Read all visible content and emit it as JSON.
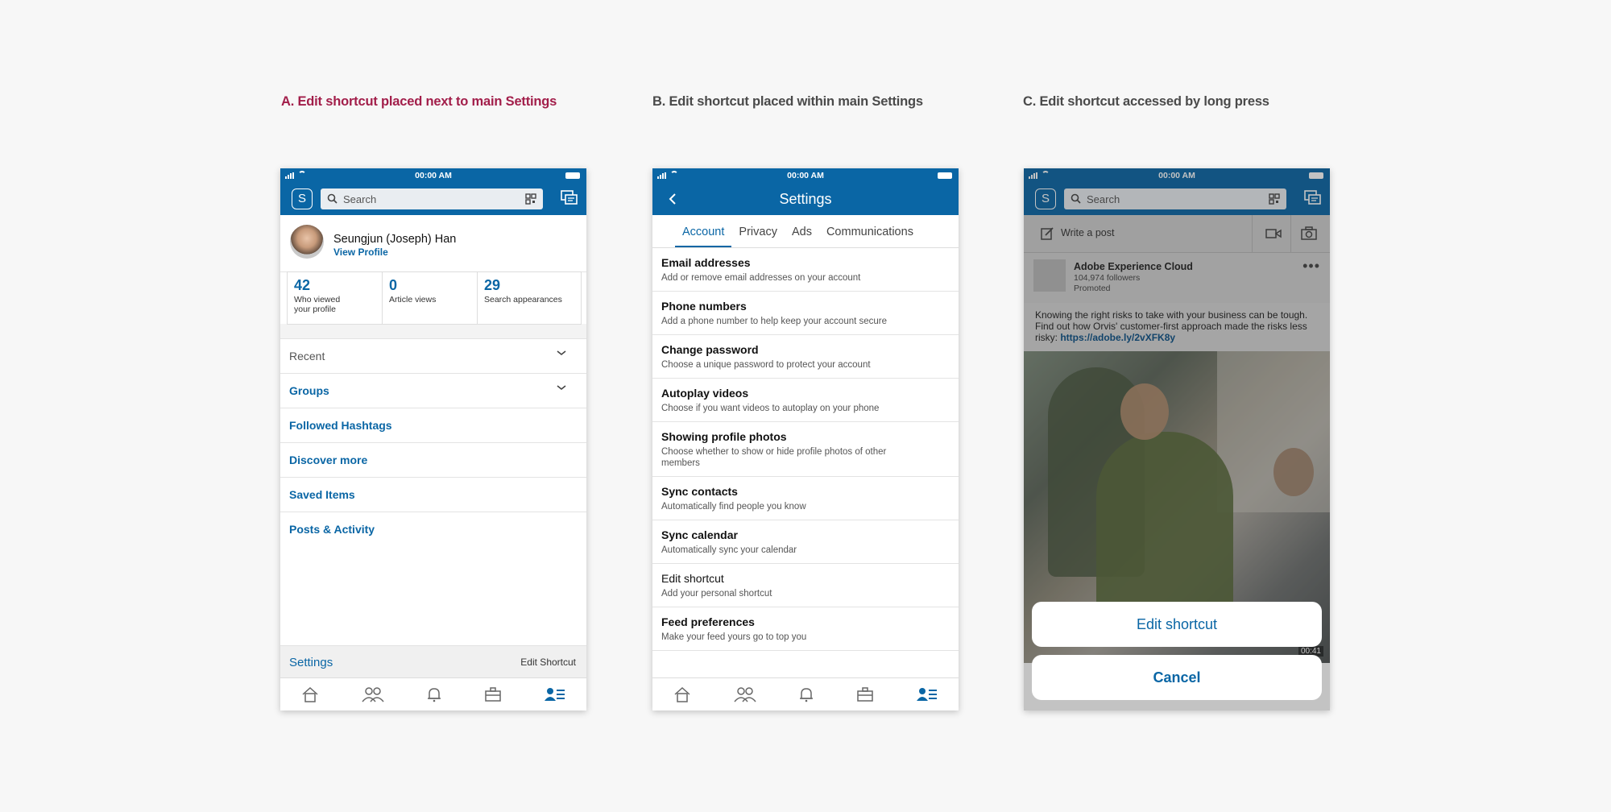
{
  "captions": {
    "a": "A. Edit shortcut placed next to main Settings",
    "b": "B. Edit shortcut placed within main Settings",
    "c": "C. Edit shortcut accessed by long press"
  },
  "status_time": "00:00 AM",
  "search": {
    "placeholder": "Search",
    "avatar_letter": "S"
  },
  "phone_a": {
    "name": "Seungjun (Joseph) Han",
    "view_profile": "View Profile",
    "stats": [
      {
        "num": "42",
        "label": "Who viewed your profile"
      },
      {
        "num": "0",
        "label": "Article views"
      },
      {
        "num": "29",
        "label": "Search appearances"
      }
    ],
    "rows": [
      "Recent",
      "Groups",
      "Followed Hashtags",
      "Discover more",
      "Saved Items",
      "Posts & Activity"
    ],
    "footer_settings": "Settings",
    "footer_edit": "Edit Shortcut"
  },
  "phone_b": {
    "title": "Settings",
    "tabs": [
      "Account",
      "Privacy",
      "Ads",
      "Communications"
    ],
    "items": [
      {
        "title": "Email addresses",
        "desc": "Add or remove email addresses on your account"
      },
      {
        "title": "Phone numbers",
        "desc": "Add a phone number to help keep your account secure"
      },
      {
        "title": "Change password",
        "desc": "Choose a unique password to protect your account"
      },
      {
        "title": "Autoplay videos",
        "desc": "Choose if you want videos to autoplay on your phone"
      },
      {
        "title": "Showing profile photos",
        "desc": "Choose whether to show or hide profile photos of other members"
      },
      {
        "title": "Sync contacts",
        "desc": "Automatically find people you know"
      },
      {
        "title": "Sync calendar",
        "desc": "Automatically sync your calendar"
      },
      {
        "title": "Edit shortcut",
        "desc": "Add your personal shortcut"
      },
      {
        "title": "Feed preferences",
        "desc": "Make your feed yours go to top you"
      }
    ]
  },
  "phone_c": {
    "write_post": "Write a post",
    "ad_name": "Adobe Experience Cloud",
    "ad_followers": "104,974 followers",
    "ad_promoted": "Promoted",
    "ad_text": "Knowing the right risks to take with your business can be tough. Find out how Orvis' customer-first approach made the risks less risky: ",
    "ad_link": "https://adobe.ly/2vXFK8y",
    "video_time": "00:41",
    "sheet_edit": "Edit shortcut",
    "sheet_cancel": "Cancel"
  },
  "colors": {
    "brand": "#0a66a5",
    "caption_a": "#a21e4a",
    "caption_other": "#4a4a4a"
  }
}
